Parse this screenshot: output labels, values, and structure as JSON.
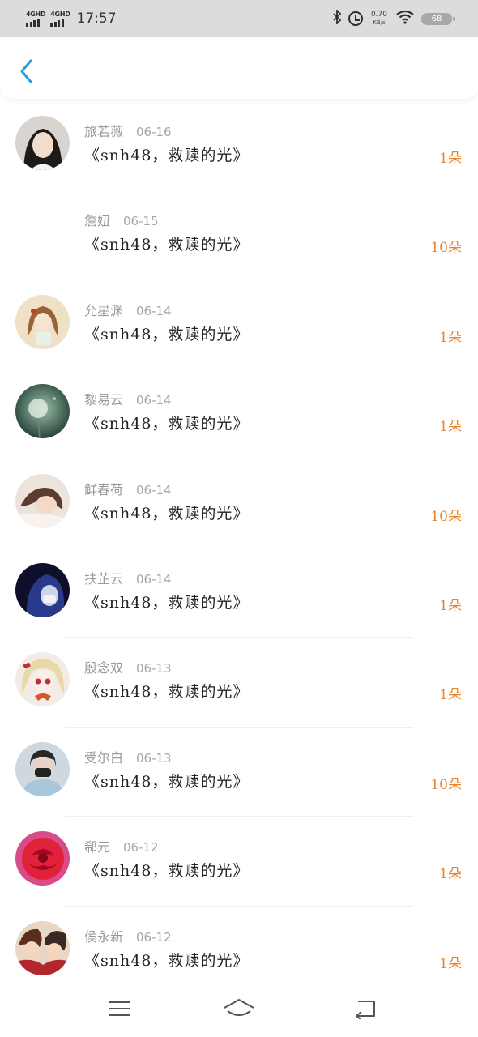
{
  "status_bar": {
    "network_1": "4GHD",
    "network_2": "4GHD",
    "time": "17:57",
    "speed_value": "0.70",
    "speed_unit": "KB/s",
    "battery": "68",
    "icons": [
      "signal-icon",
      "bluetooth-icon",
      "alarm-icon",
      "wifi-icon",
      "battery-icon"
    ]
  },
  "header": {
    "back_icon": "chevron-left-icon",
    "accent": "#2d9ae0"
  },
  "colors": {
    "count": "#e8842f",
    "name": "#9a9a9a",
    "title": "#222222"
  },
  "list": [
    {
      "name": "旅若薇",
      "date": "06-16",
      "title": "《snh48，救赎的光》",
      "count": "1朵",
      "avatar": "girl-photo"
    },
    {
      "name": "詹妞",
      "date": "06-15",
      "title": "《snh48，救赎的光》",
      "count": "10朵",
      "avatar": "none"
    },
    {
      "name": "允星渊",
      "date": "06-14",
      "title": "《snh48，救赎的光》",
      "count": "1朵",
      "avatar": "anime-girl"
    },
    {
      "name": "黎易云",
      "date": "06-14",
      "title": "《snh48，救赎的光》",
      "count": "1朵",
      "avatar": "dandelion"
    },
    {
      "name": "鲜春荷",
      "date": "06-14",
      "title": "《snh48，救赎的光》",
      "count": "10朵",
      "avatar": "girl-lying"
    },
    {
      "name": "扶芷云",
      "date": "06-14",
      "title": "《snh48，救赎的光》",
      "count": "1朵",
      "avatar": "night-hood"
    },
    {
      "name": "殷念双",
      "date": "06-13",
      "title": "《snh48，救赎的光》",
      "count": "1朵",
      "avatar": "anime-blonde"
    },
    {
      "name": "受尔白",
      "date": "06-13",
      "title": "《snh48，救赎的光》",
      "count": "10朵",
      "avatar": "masked-boy"
    },
    {
      "name": "郗元",
      "date": "06-12",
      "title": "《snh48，救赎的光》",
      "count": "1朵",
      "avatar": "red-rose"
    },
    {
      "name": "侯永新",
      "date": "06-12",
      "title": "《snh48，救赎的光》",
      "count": "1朵",
      "avatar": "anime-couple"
    }
  ],
  "nav_bar": {
    "icons": [
      "menu-icon",
      "home-icon",
      "back-icon"
    ]
  }
}
